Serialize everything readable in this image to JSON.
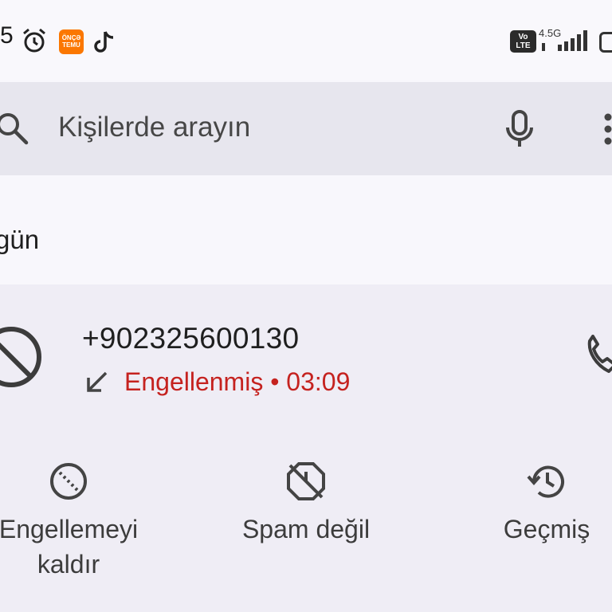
{
  "status_bar": {
    "time_fragment": "5",
    "icons": [
      "alarm-icon",
      "temu-app-icon",
      "tiktok-icon",
      "volte-icon",
      "signal-icon",
      "battery-icon"
    ],
    "temu_label_line1": "ÖNÇƏ",
    "temu_label_line2": "TEMU",
    "volte_line1": "Vo",
    "volte_line2": "LTE",
    "network": "4.5G"
  },
  "search": {
    "placeholder": "Kişilerde arayın",
    "icons": [
      "search-icon",
      "microphone-icon",
      "more-vert-icon"
    ]
  },
  "section": {
    "label": "gün"
  },
  "call": {
    "number": "+902325600130",
    "status": "Engellenmiş • 03:09",
    "status_color": "#c5221f",
    "icons": [
      "blocked-icon",
      "incoming-arrow-icon",
      "phone-icon"
    ]
  },
  "actions": [
    {
      "label_line1": "Engellemeyi",
      "label_line2": "kaldır",
      "icon": "unblock-icon"
    },
    {
      "label_line1": "Spam değil",
      "icon": "not-spam-icon"
    },
    {
      "label_line1": "Geçmiş",
      "icon": "history-icon"
    }
  ]
}
